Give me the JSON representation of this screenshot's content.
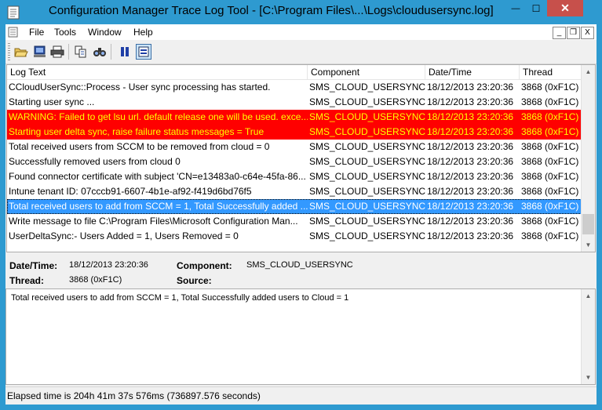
{
  "window": {
    "title": "Configuration Manager Trace Log Tool - [C:\\Program Files\\...\\Logs\\cloudusersync.log]",
    "minimize_label": "—",
    "maximize_label": "☐",
    "close_label": "✕"
  },
  "menu": {
    "items": [
      "File",
      "Tools",
      "Window",
      "Help"
    ],
    "mdi_minimize": "_",
    "mdi_restore": "❐",
    "mdi_close": "X"
  },
  "toolbar": {
    "icons": [
      "open-icon",
      "print-preview-icon",
      "print-icon",
      "copy-icon",
      "find-icon",
      "pause-icon",
      "highlight-icon"
    ]
  },
  "log": {
    "columns": [
      "Log Text",
      "Component",
      "Date/Time",
      "Thread"
    ],
    "rows": [
      {
        "text": "CCloudUserSync::Process - User sync processing has started.",
        "component": "SMS_CLOUD_USERSYNC",
        "datetime": "18/12/2013 23:20:36",
        "thread": "3868 (0xF1C)",
        "style": "normal"
      },
      {
        "text": "Starting user sync ...",
        "component": "SMS_CLOUD_USERSYNC",
        "datetime": "18/12/2013 23:20:36",
        "thread": "3868 (0xF1C)",
        "style": "normal"
      },
      {
        "text": "WARNING: Failed to get lsu url. default release one will be used. exce...",
        "component": "SMS_CLOUD_USERSYNC",
        "datetime": "18/12/2013 23:20:36",
        "thread": "3868 (0xF1C)",
        "style": "error"
      },
      {
        "text": "Starting user delta sync, raise failure status messages = True",
        "component": "SMS_CLOUD_USERSYNC",
        "datetime": "18/12/2013 23:20:36",
        "thread": "3868 (0xF1C)",
        "style": "error"
      },
      {
        "text": "Total received users from SCCM to be removed from cloud = 0",
        "component": "SMS_CLOUD_USERSYNC",
        "datetime": "18/12/2013 23:20:36",
        "thread": "3868 (0xF1C)",
        "style": "normal"
      },
      {
        "text": "Successfully removed users from cloud 0",
        "component": "SMS_CLOUD_USERSYNC",
        "datetime": "18/12/2013 23:20:36",
        "thread": "3868 (0xF1C)",
        "style": "normal"
      },
      {
        "text": "Found connector certificate with subject 'CN=e13483a0-c64e-45fa-86...",
        "component": "SMS_CLOUD_USERSYNC",
        "datetime": "18/12/2013 23:20:36",
        "thread": "3868 (0xF1C)",
        "style": "normal"
      },
      {
        "text": "Intune tenant ID: 07cccb91-6607-4b1e-af92-f419d6bd76f5",
        "component": "SMS_CLOUD_USERSYNC",
        "datetime": "18/12/2013 23:20:36",
        "thread": "3868 (0xF1C)",
        "style": "normal"
      },
      {
        "text": "Total received users to add from SCCM = 1, Total Successfully added ...",
        "component": "SMS_CLOUD_USERSYNC",
        "datetime": "18/12/2013 23:20:36",
        "thread": "3868 (0xF1C)",
        "style": "selected"
      },
      {
        "text": "Write message to file C:\\Program Files\\Microsoft Configuration Man...",
        "component": "SMS_CLOUD_USERSYNC",
        "datetime": "18/12/2013 23:20:36",
        "thread": "3868 (0xF1C)",
        "style": "normal"
      },
      {
        "text": "UserDeltaSync:- Users Added = 1, Users Removed = 0",
        "component": "SMS_CLOUD_USERSYNC",
        "datetime": "18/12/2013 23:20:36",
        "thread": "3868 (0xF1C)",
        "style": "normal"
      }
    ]
  },
  "details": {
    "datetime_label": "Date/Time:",
    "datetime_value": "18/12/2013 23:20:36",
    "component_label": "Component:",
    "component_value": "SMS_CLOUD_USERSYNC",
    "thread_label": "Thread:",
    "thread_value": "3868 (0xF1C)",
    "source_label": "Source:",
    "source_value": ""
  },
  "message": "Total received users to add from SCCM = 1, Total Successfully added users to Cloud = 1",
  "status": "Elapsed time is 204h 41m 37s 576ms (736897.576 seconds)",
  "colors": {
    "titlebar": "#2e9ad0",
    "error_bg": "#ff0000",
    "error_text": "#ffff00",
    "selected_bg": "#3399ff",
    "close_button": "#c7504b"
  }
}
